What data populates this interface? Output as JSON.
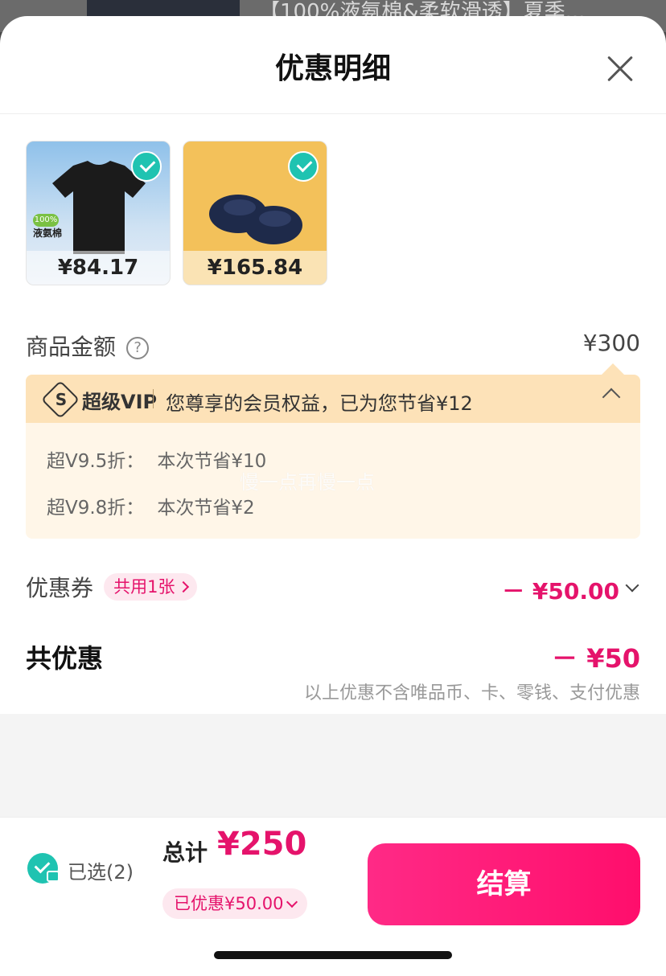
{
  "background": {
    "title_snippet": "【100%液氨棉&柔软滑透】夏季..."
  },
  "sheet": {
    "title": "优惠明细"
  },
  "products": [
    {
      "price": "¥84.17",
      "badge": "100%",
      "label": "液氨棉",
      "selected": true
    },
    {
      "price": "¥165.84",
      "selected": true
    }
  ],
  "amount": {
    "label": "商品金额",
    "help": "?",
    "value": "¥300"
  },
  "vip": {
    "brand": "超级VIP",
    "desc": "您尊享的会员权益，已为您节省¥12",
    "lines": [
      {
        "key": "超V9.5折：",
        "value": "本次节省¥10"
      },
      {
        "key": "超V9.8折：",
        "value": "本次节省¥2"
      }
    ]
  },
  "watermark": "慢一点再慢一点",
  "coupon": {
    "label": "优惠券",
    "pill": "共用1张",
    "value": "－ ¥50.00"
  },
  "total_discount": {
    "label": "共优惠",
    "value": "－ ¥50",
    "note": "以上优惠不含唯品币、卡、零钱、支付优惠"
  },
  "footer": {
    "selected_label": "已选(2)",
    "total_label": "总计",
    "total_value": "¥250",
    "saved_label": "已优惠¥50.00",
    "checkout_label": "结算"
  },
  "colors": {
    "accent": "#e5136b",
    "check": "#1fc3b1",
    "vip_bg": "#fff6e8"
  }
}
